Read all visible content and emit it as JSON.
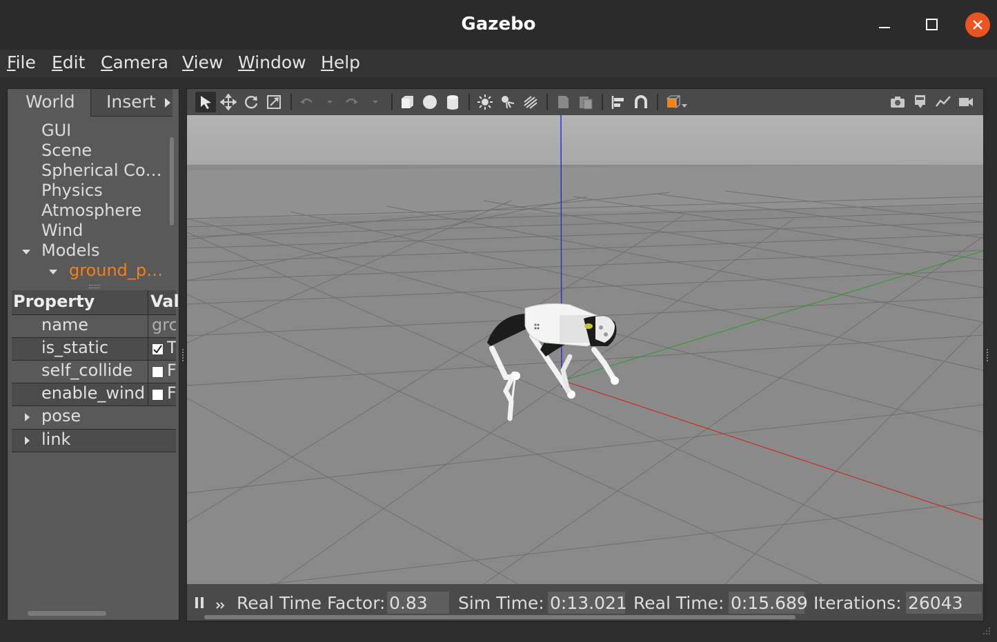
{
  "window": {
    "title": "Gazebo"
  },
  "menu": [
    "File",
    "Edit",
    "Camera",
    "View",
    "Window",
    "Help"
  ],
  "menu_mnemonic": [
    "F",
    "E",
    "C",
    "V",
    "W",
    "H"
  ],
  "menu_rest": [
    "ile",
    "dit",
    "amera",
    "iew",
    "indow",
    "elp"
  ],
  "left_panel": {
    "tabs": [
      "World",
      "Insert"
    ],
    "tree": {
      "items": [
        "GUI",
        "Scene",
        "Spherical Co…",
        "Physics",
        "Atmosphere",
        "Wind"
      ],
      "models_label": "Models",
      "selected_model": "ground_p…"
    },
    "properties": {
      "header_property": "Property",
      "header_value": "Val",
      "rows": [
        {
          "name": "name",
          "value": "grc"
        },
        {
          "name": "is_static",
          "value": "T",
          "checked": true
        },
        {
          "name": "self_collide",
          "value": "F",
          "checked": false
        },
        {
          "name": "enable_wind",
          "value": "F",
          "checked": false
        }
      ],
      "groups": [
        "pose",
        "link"
      ]
    }
  },
  "toolbar": {
    "icons": [
      "select-mode-icon",
      "translate-mode-icon",
      "rotate-mode-icon",
      "scale-mode-icon",
      "undo-icon",
      "redo-icon",
      "box-icon",
      "sphere-icon",
      "cylinder-icon",
      "point-light-icon",
      "spot-light-icon",
      "directional-light-icon",
      "copy-icon",
      "paste-icon",
      "align-icon",
      "snap-icon",
      "view-angle-icon",
      "screenshot-icon",
      "log-icon",
      "plot-icon",
      "video-record-icon"
    ]
  },
  "status": {
    "rtf_label": "Real Time Factor:",
    "rtf_value": "0.83",
    "sim_label": "Sim Time:",
    "sim_value": "0:13.021",
    "real_label": "Real Time:",
    "real_value": "0:15.689",
    "iter_label": "Iterations:",
    "iter_value": "26043"
  },
  "colors": {
    "selected_model": "#f58113",
    "close_button": "#e95420"
  }
}
